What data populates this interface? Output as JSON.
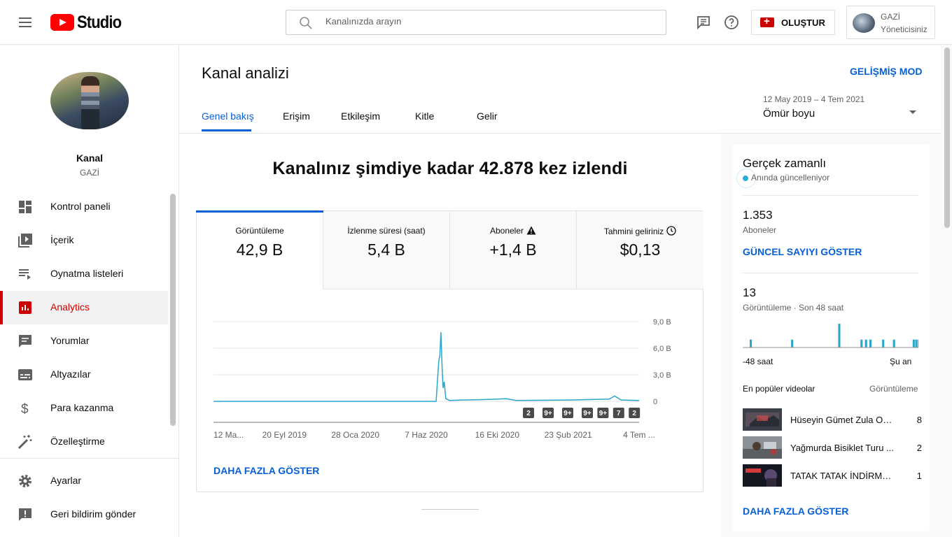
{
  "header": {
    "logo_text": "Studio",
    "search_placeholder": "Kanalınızda arayın",
    "create_label": "OLUŞTUR",
    "account_name": "GAZİ",
    "account_role": "Yöneticisiniz"
  },
  "sidebar": {
    "channel_label": "Kanal",
    "channel_name": "GAZİ",
    "items": [
      {
        "label": "Kontrol paneli",
        "icon": "dashboard-icon"
      },
      {
        "label": "İçerik",
        "icon": "content-icon"
      },
      {
        "label": "Oynatma listeleri",
        "icon": "playlist-icon"
      },
      {
        "label": "Analytics",
        "icon": "analytics-icon",
        "active": true
      },
      {
        "label": "Yorumlar",
        "icon": "comments-icon"
      },
      {
        "label": "Altyazılar",
        "icon": "subtitles-icon"
      },
      {
        "label": "Para kazanma",
        "icon": "dollar-icon"
      },
      {
        "label": "Özelleştirme",
        "icon": "magic-wand-icon"
      },
      {
        "label": "Ayarlar",
        "icon": "gear-icon"
      },
      {
        "label": "Geri bildirim gönder",
        "icon": "feedback-icon"
      }
    ]
  },
  "page": {
    "title": "Kanal analizi",
    "advanced_mode": "GELİŞMİŞ MOD",
    "tabs": [
      "Genel bakış",
      "Erişim",
      "Etkileşim",
      "Kitle",
      "Gelir"
    ],
    "date_range": "12 May 2019 – 4 Tem 2021",
    "period": "Ömür boyu",
    "headline": "Kanalınız şimdiye kadar 42.878 kez izlendi",
    "more_label": "DAHA FAZLA GÖSTER"
  },
  "metrics": [
    {
      "title": "Görüntüleme",
      "value": "42,9 B"
    },
    {
      "title": "İzlenme süresi (saat)",
      "value": "5,4 B"
    },
    {
      "title": "Aboneler",
      "value": "+1,4 B"
    },
    {
      "title": "Tahmini geliriniz",
      "value": "$0,13"
    }
  ],
  "chart_data": {
    "type": "line",
    "title": "",
    "xlabel": "",
    "ylabel": "",
    "x_tick_labels": [
      "12 Ma...",
      "20 Eyl 2019",
      "28 Oca 2020",
      "7 Haz 2020",
      "16 Eki 2020",
      "23 Şub 2021",
      "4 Tem ..."
    ],
    "y_tick_labels": [
      "9,0 B",
      "6,0 B",
      "3,0 B",
      "0"
    ],
    "ylim": [
      0,
      9000
    ],
    "series": [
      {
        "color": "#2ba6cb",
        "points": [
          [
            "12 May 2019",
            0
          ],
          [
            "20 Eyl 2019",
            0
          ],
          [
            "28 Oca 2020",
            0
          ],
          [
            "7 Haz 2020",
            0
          ],
          [
            "25 Haz 2020",
            0
          ],
          [
            "30 Haz 2020",
            4500
          ],
          [
            "2 Tem 2020",
            5200
          ],
          [
            "4 Tem 2020",
            7800
          ],
          [
            "6 Tem 2020",
            4000
          ],
          [
            "8 Tem 2020",
            1500
          ],
          [
            "10 Tem 2020",
            2200
          ],
          [
            "13 Tem 2020",
            300
          ],
          [
            "20 Tem 2020",
            100
          ],
          [
            "10 Ağu 2020",
            150
          ],
          [
            "20 Eyl 2020",
            200
          ],
          [
            "16 Eki 2020",
            250
          ],
          [
            "1 Kas 2020",
            300
          ],
          [
            "20 Kas 2020",
            100
          ],
          [
            "23 Şub 2021",
            150
          ],
          [
            "1 Nis 2021",
            200
          ],
          [
            "10 May 2021",
            250
          ],
          [
            "20 May 2021",
            600
          ],
          [
            "1 Haz 2021",
            150
          ],
          [
            "4 Tem 2021",
            100
          ]
        ]
      }
    ],
    "markers": [
      "2",
      "9+",
      "9+",
      "9+",
      "9+",
      "7",
      "2"
    ]
  },
  "realtime": {
    "title": "Gerçek zamanlı",
    "live_label": "Anında güncelleniyor",
    "subscribers": "1.353",
    "subscribers_label": "Aboneler",
    "count_button": "GÜNCEL SAYIYI GÖSTER",
    "views": "13",
    "views_label": "Görüntüleme · Son 48 saat",
    "bar_values": [
      0,
      0,
      0,
      0,
      0,
      0,
      0,
      0,
      0,
      0,
      0,
      1,
      0,
      0,
      0,
      0,
      0,
      0,
      0,
      0,
      0,
      0,
      0,
      0,
      0,
      0,
      0,
      0,
      0,
      0,
      0,
      0,
      0,
      0,
      0,
      0,
      0,
      0,
      0,
      0,
      0,
      0,
      0,
      0,
      0,
      0,
      0,
      0,
      0,
      0,
      0,
      0,
      0,
      0,
      0,
      0,
      0,
      0,
      0,
      0,
      0,
      0,
      0,
      0,
      0,
      0,
      0,
      0,
      0,
      0,
      0,
      0,
      0,
      0,
      0,
      0,
      1,
      0,
      0,
      0,
      0,
      0,
      0,
      0,
      0,
      0,
      0,
      0,
      0,
      0,
      0,
      0,
      0,
      0,
      0,
      0,
      0,
      0,
      0,
      0,
      0,
      0,
      0,
      0,
      0,
      0,
      0,
      0,
      0,
      0,
      0,
      0,
      0,
      0,
      0,
      0,
      0,
      0,
      0,
      0,
      0,
      0,
      0,
      0,
      0,
      0,
      0,
      0,
      0,
      0,
      0,
      0,
      0,
      0,
      0,
      0,
      0,
      0,
      0,
      0,
      0,
      0,
      0,
      0,
      0,
      0,
      0,
      0,
      0,
      0,
      3,
      0,
      0,
      0,
      0,
      0,
      0,
      0,
      0,
      0,
      0,
      0,
      0,
      0,
      0,
      0,
      0,
      0,
      0,
      0,
      0,
      0,
      0,
      0,
      0,
      0,
      0,
      0,
      0,
      0,
      0,
      0,
      0,
      0,
      0,
      1,
      0,
      0,
      0,
      0,
      0,
      0,
      1,
      0,
      0,
      0,
      0,
      0,
      0,
      1,
      0,
      0,
      0,
      0,
      0,
      0,
      0,
      0,
      0,
      0,
      0,
      0,
      0,
      0,
      0,
      0,
      0,
      0,
      0,
      1,
      0,
      0,
      0,
      0,
      0,
      0,
      0,
      0,
      0,
      0,
      0,
      0,
      0,
      0,
      0,
      0,
      1,
      0,
      0,
      0,
      0,
      0,
      0,
      0,
      0,
      0,
      0,
      0,
      0,
      0,
      0,
      0,
      0,
      0,
      0,
      0,
      0,
      0,
      0,
      0,
      0,
      0,
      0,
      0,
      0,
      0,
      0,
      1,
      0,
      0,
      0,
      1,
      0,
      0,
      0,
      1
    ],
    "start_label": "-48 saat",
    "end_label": "Şu an",
    "popular_header": "En popüler videolar",
    "popular_header_right": "Görüntüleme",
    "videos": [
      {
        "title": "Hüseyin Gümet Zula Oynuyor",
        "views": "8"
      },
      {
        "title": "Yağmurda Bisiklet Turu ...",
        "views": "2"
      },
      {
        "title": "TATAK TATAK İNDİRMEYİN",
        "views": "1"
      }
    ],
    "more_label": "DAHA FAZLA GÖSTER"
  }
}
